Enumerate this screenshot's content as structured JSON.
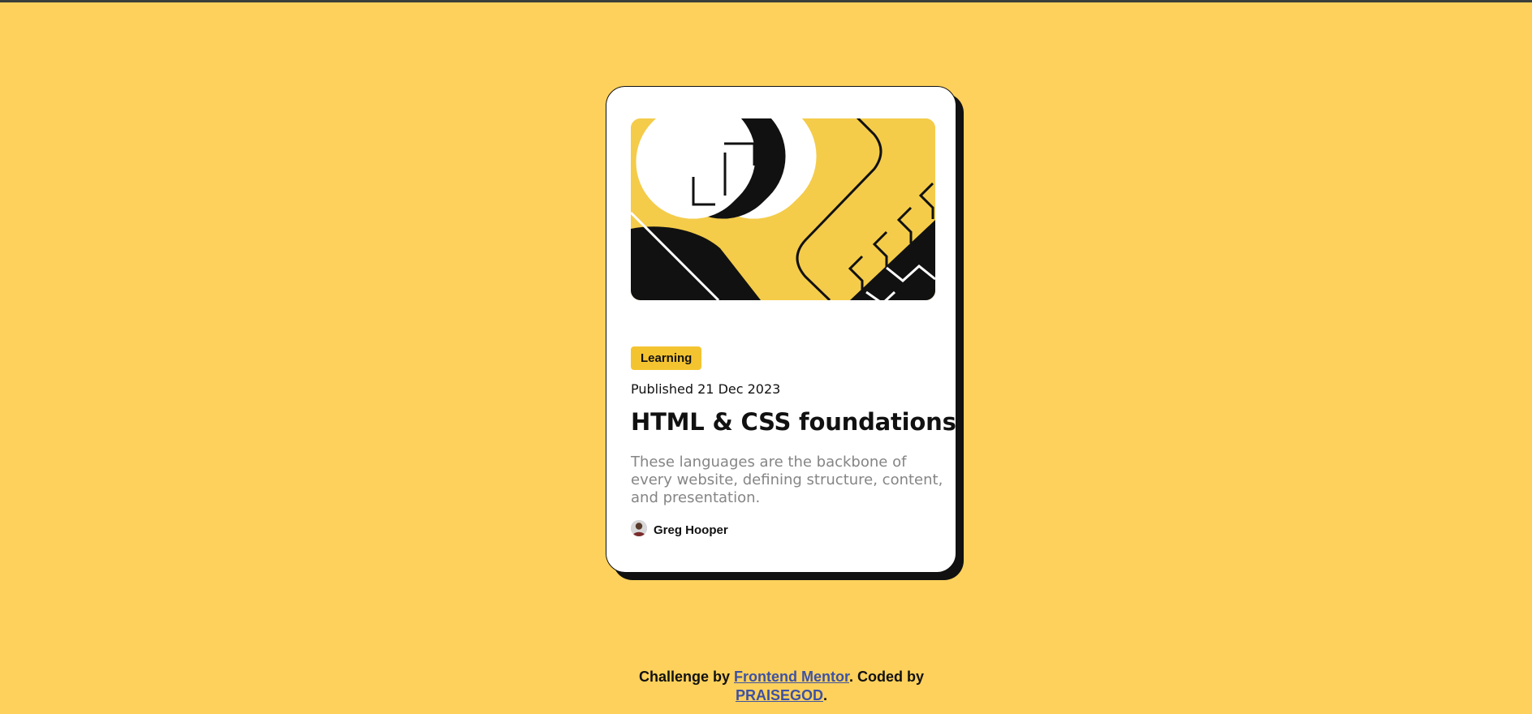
{
  "card": {
    "tag": "Learning",
    "published": "Published 21 Dec 2023",
    "title": "HTML & CSS foundations",
    "description": "These languages are the backbone of every website, defining structure, content, and presentation.",
    "author": {
      "name": "Greg Hooper",
      "avatar_icon": "avatar-image"
    },
    "illustration_icon": "abstract-illustration"
  },
  "attribution": {
    "prefix": "Challenge by ",
    "link1": "Frontend Mentor",
    "middle": ". Coded by ",
    "link2": "PRAISEGOD",
    "suffix": "."
  },
  "colors": {
    "background": "#fed15c",
    "accent": "#f4c430",
    "text": "#111111",
    "muted": "#858585",
    "link": "#3e52a3"
  }
}
